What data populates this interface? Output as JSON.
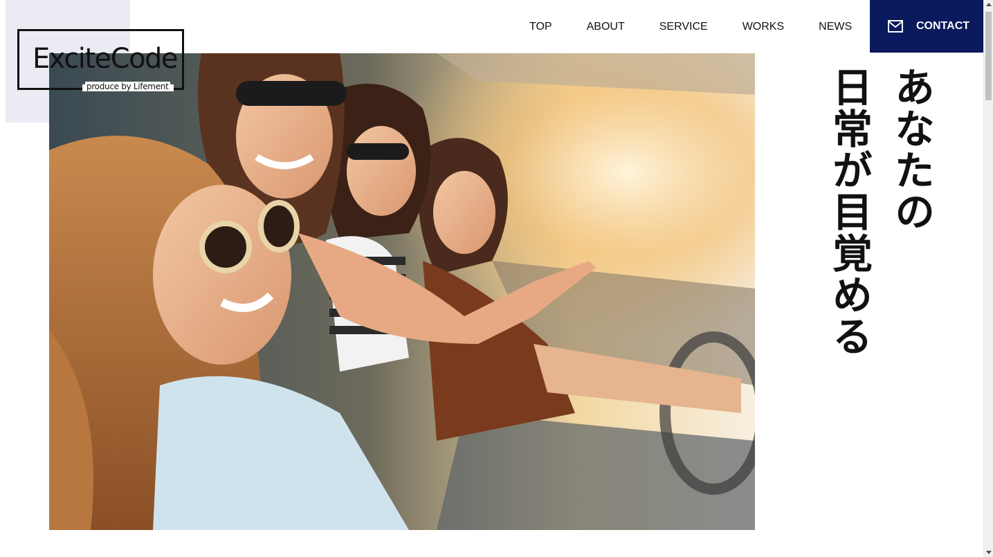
{
  "logo": {
    "title": "ExciteCode",
    "subtitle": "produce by Lifement"
  },
  "nav": {
    "items": [
      {
        "label": "TOP"
      },
      {
        "label": "ABOUT"
      },
      {
        "label": "SERVICE"
      },
      {
        "label": "WORKS"
      },
      {
        "label": "NEWS"
      }
    ],
    "contact": {
      "label": "CONTACT",
      "icon": "mail-icon"
    }
  },
  "hero": {
    "image": "photo of four smiling women in sunglasses riding in a car",
    "catchphrase": {
      "line1": "あなたの",
      "line2": "日常が目覚める"
    }
  },
  "colors": {
    "contact_bg": "#0a1a5c",
    "logo_bg": "#ebebf4",
    "text": "#111111"
  }
}
